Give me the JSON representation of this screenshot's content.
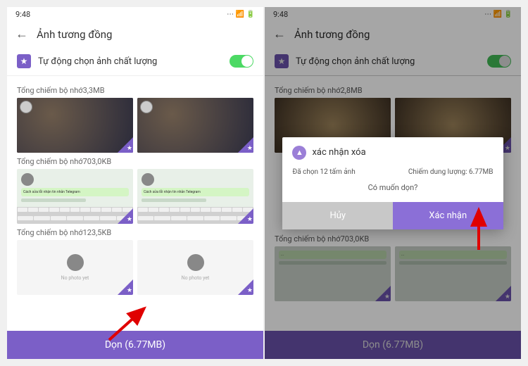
{
  "status": {
    "time": "9:48",
    "icons": "⋯  📶  🔋"
  },
  "header": {
    "title": "Ảnh tương đồng"
  },
  "toggle": {
    "label": "Tự động chọn ảnh chất lượng"
  },
  "left": {
    "groups": [
      {
        "label": "Tổng chiếm bộ nhớ3,3MB"
      },
      {
        "label": "Tổng chiếm bộ nhớ703,0KB"
      },
      {
        "label": "Tổng chiếm bộ nhớ123,5KB"
      }
    ],
    "empty_text": "No photo yet",
    "bottom_button": "Dọn (6.77MB)"
  },
  "right": {
    "groups": [
      {
        "label": "Tổng chiếm bộ nhớ2,8MB"
      },
      {
        "label": "Tổng chiếm bộ nhớ703,0KB"
      }
    ],
    "bottom_button": "Dọn (6.77MB)"
  },
  "dialog": {
    "title": "xác nhận xóa",
    "selected": "Đã chọn 12 tấm ảnh",
    "size": "Chiếm dung lượng: 6.77MB",
    "question": "Có muốn dọn?",
    "cancel": "Hủy",
    "confirm": "Xác nhận"
  }
}
